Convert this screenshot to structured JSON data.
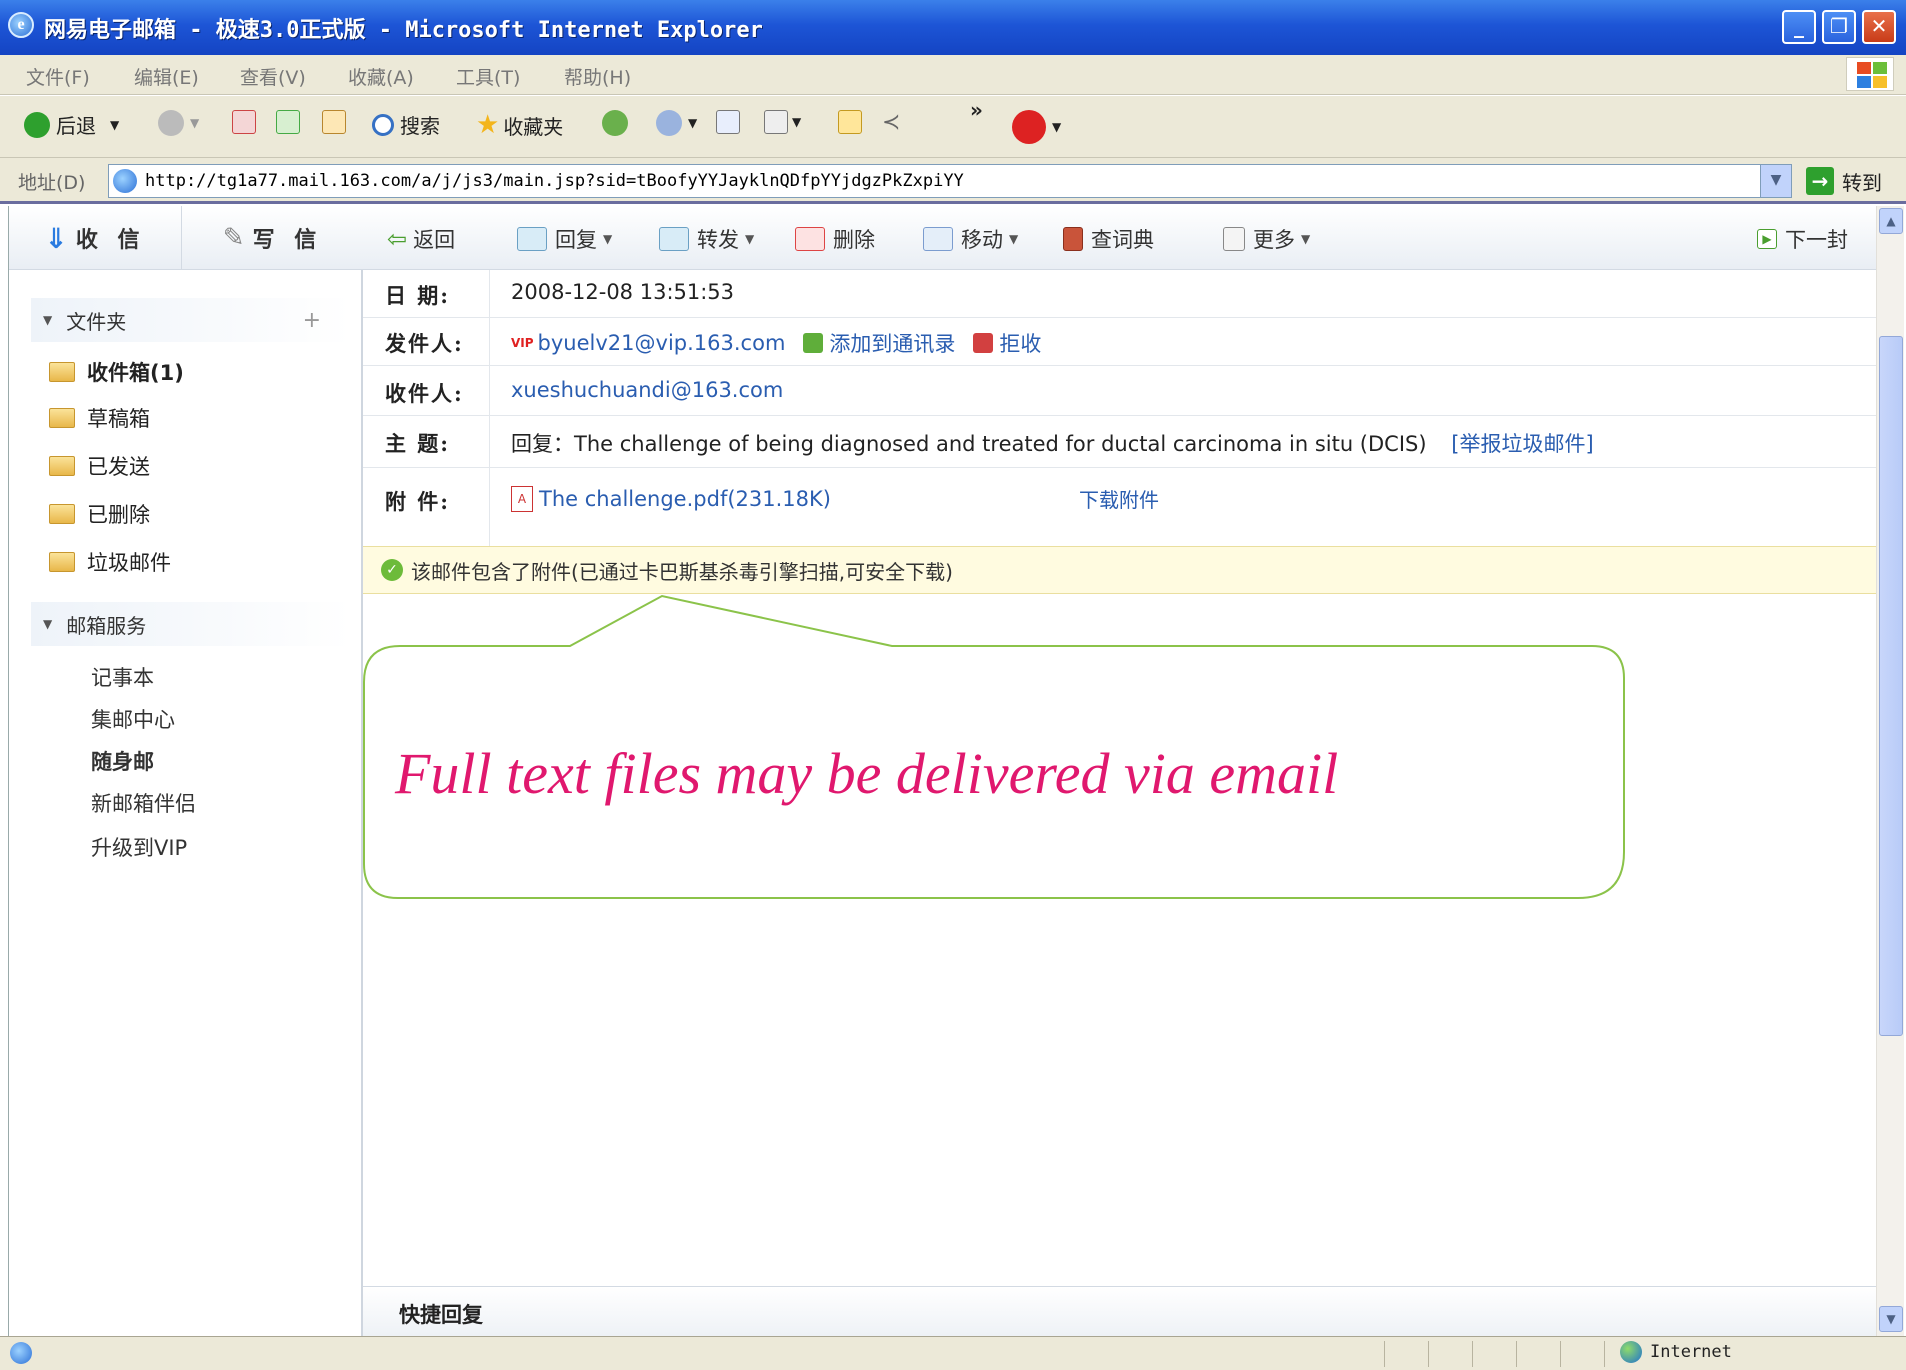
{
  "window": {
    "title": "网易电子邮箱 - 极速3.0正式版 - Microsoft Internet Explorer",
    "minimize": "_",
    "restore": "❐",
    "close": "✕"
  },
  "menubar": [
    "文件(F)",
    "编辑(E)",
    "查看(V)",
    "收藏(A)",
    "工具(T)",
    "帮助(H)"
  ],
  "toolbar": {
    "back": "后退",
    "search": "搜索",
    "favorites": "收藏夹",
    "more": "»"
  },
  "address": {
    "label": "地址(D)",
    "url": "http://tg1a77.mail.163.com/a/j/js3/main.jsp?sid=tBoofyYYJayklnQDfpYYjdgzPkZxpiYY",
    "go": "转到"
  },
  "sidebar": {
    "receive": "收 信",
    "compose": "写 信",
    "folders_title": "文件夹",
    "add_symbol": "+",
    "folders": [
      {
        "label": "收件箱(1)",
        "bold": true
      },
      {
        "label": "草稿箱"
      },
      {
        "label": "已发送"
      },
      {
        "label": "已删除"
      },
      {
        "label": "垃圾邮件"
      }
    ],
    "services_title": "邮箱服务",
    "services": [
      "记事本",
      "集邮中心",
      "随身邮",
      "新邮箱伴侣",
      "升级到VIP"
    ]
  },
  "mail_toolbar": {
    "back": "返回",
    "reply": "回复",
    "forward": "转发",
    "delete": "删除",
    "move": "移动",
    "dictionary": "查词典",
    "more": "更多",
    "next": "下一封"
  },
  "header": {
    "date_label": "日 期:",
    "date": "2008-12-08 13:51:53",
    "from_label": "发件人:",
    "vip_badge": "VIP",
    "from": "byuelv21@vip.163.com",
    "add_contact": "添加到通讯录",
    "reject": "拒收",
    "to_label": "收件人:",
    "to": "xueshuchuandi@163.com",
    "subject_label": "主 题:",
    "subject": "回复：The challenge of being diagnosed and treated for ductal carcinoma in situ (DCIS)",
    "report_spam": "[举报垃圾邮件]",
    "attach_label": "附 件:",
    "attachment": "The challenge.pdf(231.18K)",
    "download": "下载附件"
  },
  "notice": "该邮件包含了附件(已通过卡巴斯基杀毒引擎扫描,可安全下载)",
  "annotation": "Full text files may be delivered via email",
  "quick_reply": "快捷回复",
  "status": {
    "zone": "Internet"
  },
  "colors": {
    "title_blue": "#1d55d6",
    "link": "#2a5db0",
    "callout_text": "#e0186e",
    "callout_border": "#8bc34a"
  }
}
